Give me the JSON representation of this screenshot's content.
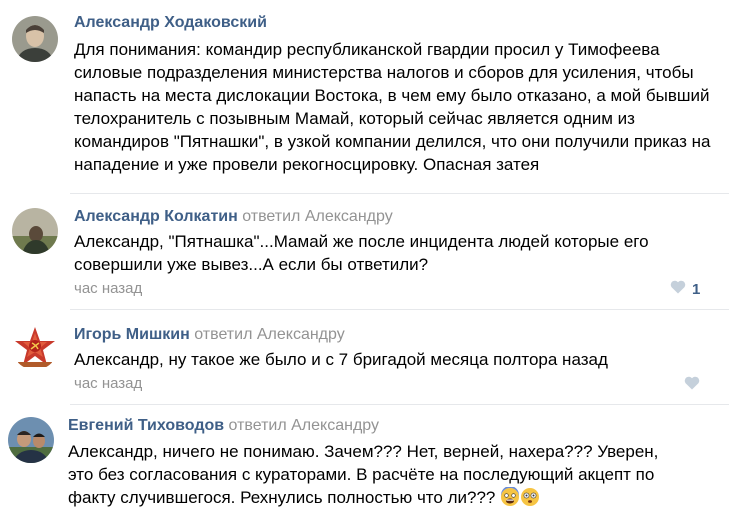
{
  "comments": [
    {
      "author": "Александр Ходаковский",
      "replied": "",
      "text": "Для понимания: командир республиканской гвардии просил у Тимофеева силовые подразделения министерства налогов и сборов для усиления, чтобы напасть на места дислокации Востока, в чем ему было отказано, а мой бывший телохранитель с позывным Мамай, который сейчас является одним из командиров \"Пятнашки\", в узкой компании делился, что они получили приказ на нападение и уже провели рекогносцировку. Опасная затея",
      "time": "",
      "likes": ""
    },
    {
      "author": "Александр Колкатин",
      "replied": " ответил Александру",
      "text": "Александр, \"Пятнашка\"...Мамай же после инцидента людей которые его совершили уже вывез...А если бы ответили?",
      "time": "час назад",
      "likes": "1"
    },
    {
      "author": "Игорь Мишкин",
      "replied": " ответил Александру",
      "text": "Александр, ну такое же было и с 7 бригадой месяца полтора назад",
      "time": "час назад",
      "likes": ""
    },
    {
      "author": "Евгений Тиховодов",
      "replied": " ответил Александру",
      "text": "Александр, ничего не понимаю. Зачем??? Нет, верней, нахера??? Уверен, это без согласования с кураторами. В расчёте на последующий акцепт по факту случившегося. Рехнулись полностью что ли???",
      "time": "",
      "likes": ""
    }
  ],
  "icons": {
    "like": "heart-icon",
    "emoji_1": "scared-face-emoji",
    "emoji_2": "flushed-face-emoji"
  },
  "colors": {
    "author": "#3f5f87",
    "muted": "#939393",
    "like_heart": "#c5d0db"
  }
}
